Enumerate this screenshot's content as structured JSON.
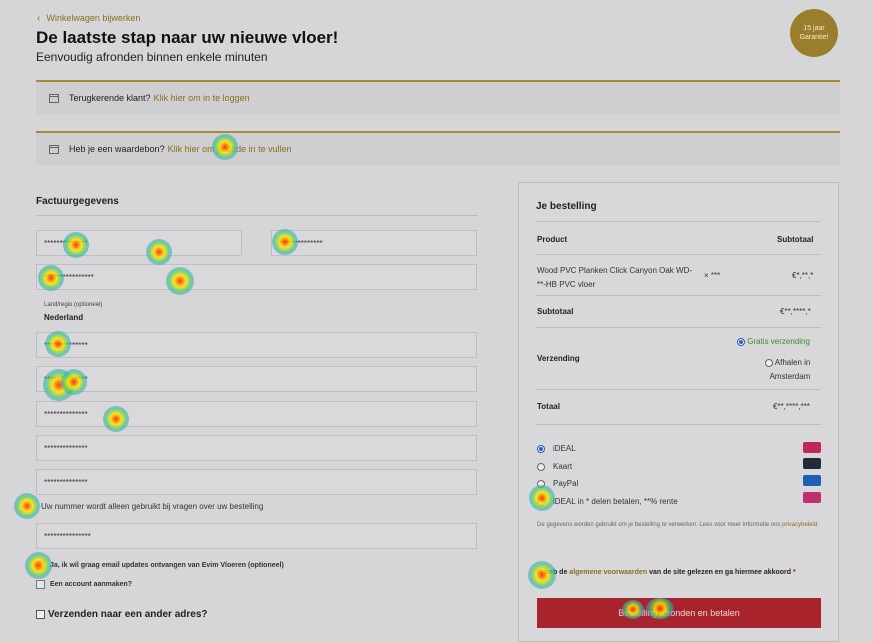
{
  "header": {
    "back_label": "Winkelwagen bijwerken",
    "title": "De laatste stap naar uw nieuwe vloer!",
    "subtitle": "Eenvoudig afronden binnen enkele minuten",
    "badge": "15 jaar Garantie!"
  },
  "notices": {
    "login_text": "Terugkerende klant?",
    "login_link": "Klik hier om in te loggen",
    "coupon_text": "Heb je een waardebon?",
    "coupon_link": "Klik hier om je code in te vullen"
  },
  "billing": {
    "title": "Factuurgegevens",
    "first_name": "**************",
    "last_name": "**************",
    "company": "****************",
    "country_label": "Land/regio (optioneel)",
    "country_value": "Nederland",
    "street": "**************",
    "house_number": "**************",
    "postcode": "**************",
    "city": "**************",
    "phone": "**************",
    "phone_note": "Uw nummer wordt alleen gebruikt bij vragen over uw bestelling",
    "email": "***************",
    "newsletter_label": "Ja, ik wil graag email updates ontvangen van Evim Vloeren (optioneel)",
    "create_account_label": "Een account aanmaken?",
    "ship_other_label": "Verzenden naar een ander adres?"
  },
  "order": {
    "title": "Je bestelling",
    "col_product": "Product",
    "col_subtotal": "Subtotaal",
    "product_name_line1": "Wood PVC Planken Click Canyon Oak WD-",
    "product_name_line2": "**-HB PVC vloer",
    "product_qty": "× ***",
    "product_price": "€*,**,*",
    "subtotal_label": "Subtotaal",
    "subtotal_value": "€**,****,*",
    "shipping_label": "Verzending",
    "shipping_free": "Gratis verzending",
    "shipping_pickup_line1": "Afhalen in",
    "shipping_pickup_line2": "Amsterdam",
    "total_label": "Totaal",
    "total_value": "€**,****,***"
  },
  "payment": {
    "methods": [
      "iDEAL",
      "Kaart",
      "PayPal",
      "iDEAL in * delen betalen, **% rente"
    ],
    "privacy_text": "De gegevens worden gebruikt om je bestelling te verwerken. Lees voor meer informatie ons",
    "privacy_link": "privacybeleid.",
    "terms_prefix": "Ik heb de",
    "terms_link": "algemene voorwaarden",
    "terms_suffix": "van de site gelezen en ga hiermee akkoord",
    "terms_required": "*",
    "button_label": "Bestelling afronden en betalen"
  },
  "colors": {
    "accent_gold": "#a88a32",
    "button_red": "#a8232c",
    "background": "#d6d6d8"
  }
}
